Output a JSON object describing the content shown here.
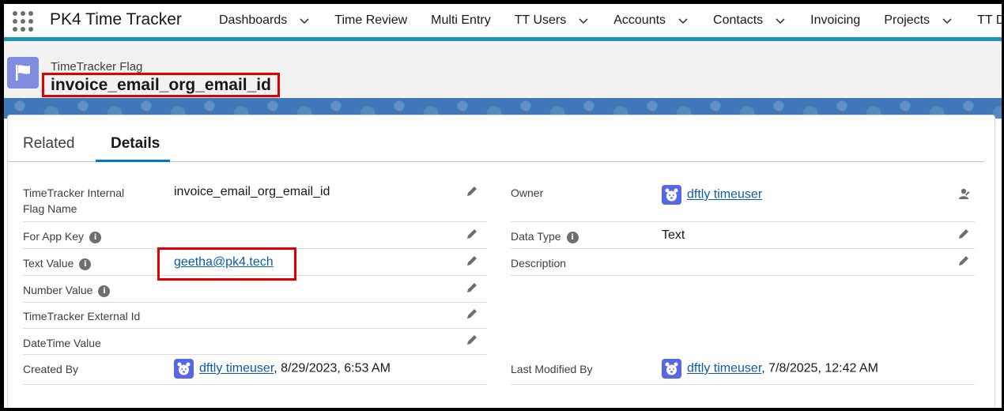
{
  "app": {
    "name": "PK4 Time Tracker"
  },
  "nav": [
    {
      "label": "Dashboards",
      "dropdown": true
    },
    {
      "label": "Time Review",
      "dropdown": false
    },
    {
      "label": "Multi Entry",
      "dropdown": false
    },
    {
      "label": "TT Users",
      "dropdown": true
    },
    {
      "label": "Accounts",
      "dropdown": true
    },
    {
      "label": "Contacts",
      "dropdown": true
    },
    {
      "label": "Invoicing",
      "dropdown": false
    },
    {
      "label": "Projects",
      "dropdown": true
    },
    {
      "label": "TT D",
      "dropdown": false
    }
  ],
  "record": {
    "type": "TimeTracker Flag",
    "name": "invoice_email_org_email_id",
    "icon": "flag-icon"
  },
  "tabs": {
    "related": "Related",
    "details": "Details"
  },
  "fields": {
    "internal_flag_name": {
      "label_line1": "TimeTracker Internal",
      "label_line2": "Flag Name",
      "value": "invoice_email_org_email_id"
    },
    "for_app_key": {
      "label": "For App Key",
      "value": ""
    },
    "text_value": {
      "label": "Text Value",
      "value": "geetha@pk4.tech"
    },
    "number_value": {
      "label": "Number Value",
      "value": ""
    },
    "external_id": {
      "label": "TimeTracker External Id",
      "value": ""
    },
    "datetime_value": {
      "label": "DateTime Value",
      "value": ""
    },
    "created_by": {
      "label": "Created By",
      "user": "dftly timeuser",
      "date": ", 8/29/2023, 6:53 AM"
    },
    "owner": {
      "label": "Owner",
      "user": "dftly timeuser"
    },
    "data_type": {
      "label": "Data Type",
      "value": "Text"
    },
    "description": {
      "label": "Description",
      "value": ""
    },
    "last_modified_by": {
      "label": "Last Modified By",
      "user": "dftly timeuser",
      "date": ", 7/8/2025, 12:42 AM"
    }
  },
  "colors": {
    "accent": "#0176d3",
    "link": "#0b5cab",
    "highlight": "#e00000",
    "brand_bar": "#1b96b2"
  }
}
